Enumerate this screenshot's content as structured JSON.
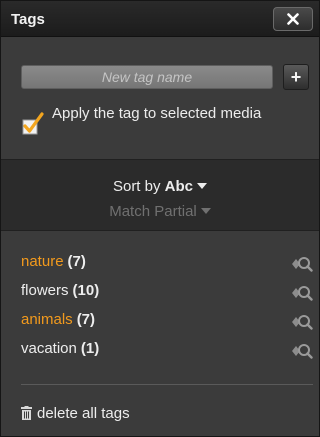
{
  "panel": {
    "title": "Tags",
    "close_icon": "close-icon"
  },
  "new_tag": {
    "placeholder": "New tag name",
    "value": "",
    "add_label": "+"
  },
  "apply": {
    "checked": true,
    "label": "Apply the tag to selected media"
  },
  "sort": {
    "sort_label": "Sort by",
    "sort_value": "Abc",
    "match_label": "Match",
    "match_value": "Partial"
  },
  "tags": [
    {
      "name": "nature",
      "count": "(7)",
      "highlighted": true
    },
    {
      "name": "flowers",
      "count": "(10)",
      "highlighted": false
    },
    {
      "name": "animals",
      "count": "(7)",
      "highlighted": true
    },
    {
      "name": "vacation",
      "count": "(1)",
      "highlighted": false
    }
  ],
  "footer": {
    "delete_all_label": "delete all tags",
    "delete_icon": "trash-icon"
  },
  "colors": {
    "highlight": "#f29a1d",
    "panel_bg": "#3b3b3b",
    "band_bg": "#2b2b2b"
  }
}
